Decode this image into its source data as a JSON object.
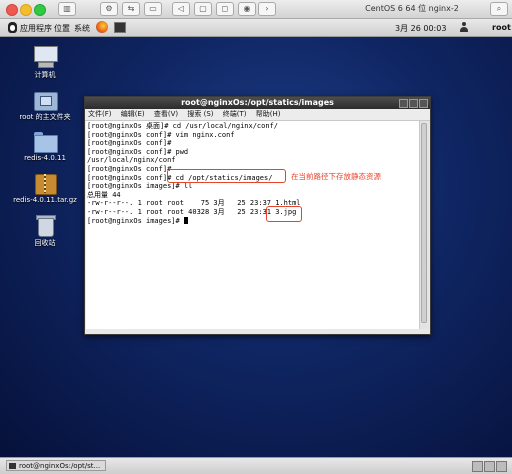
{
  "vm_window": {
    "title": "CentOS 6 64 位 nginx-2"
  },
  "guest_panel": {
    "applications": "应用程序",
    "places": "位置",
    "system": "系统",
    "datetime": "3月 26 00:03",
    "user": "root"
  },
  "desktop_icons": [
    {
      "label": "计算机"
    },
    {
      "label": "root 的主文件夹"
    },
    {
      "label": "redis-4.0.11"
    },
    {
      "label": "redis-4.0.11.tar.gz"
    },
    {
      "label": "回收站"
    }
  ],
  "terminal": {
    "title": "root@nginxOs:/opt/statics/images",
    "menu": [
      "文件(F)",
      "编辑(E)",
      "查看(V)",
      "搜索 (S)",
      "终端(T)",
      "帮助(H)"
    ],
    "lines": [
      "[root@nginxOs 桌面]# cd /usr/local/nginx/conf/",
      "[root@nginxOs conf]# vim nginx.conf",
      "[root@nginxOs conf]#",
      "[root@nginxOs conf]# pwd",
      "/usr/local/nginx/conf",
      "[root@nginxOs conf]#",
      "[root@nginxOs conf]# cd /opt/statics/images/",
      "[root@nginxOs images]# ll",
      "总用量 44",
      "-rw-r--r--. 1 root root    75 3月   25 23:37 1.html",
      "-rw-r--r--. 1 root root 40328 3月   25 23:31 3.jpg",
      "[root@nginxOs images]# "
    ]
  },
  "annotation": {
    "text": "在当前路径下存放静态资源"
  },
  "taskbar": {
    "task_label": "root@nginxOs:/opt/st..."
  },
  "colors": {
    "annotation": "#e8442b",
    "desktop": "#0f2562"
  }
}
